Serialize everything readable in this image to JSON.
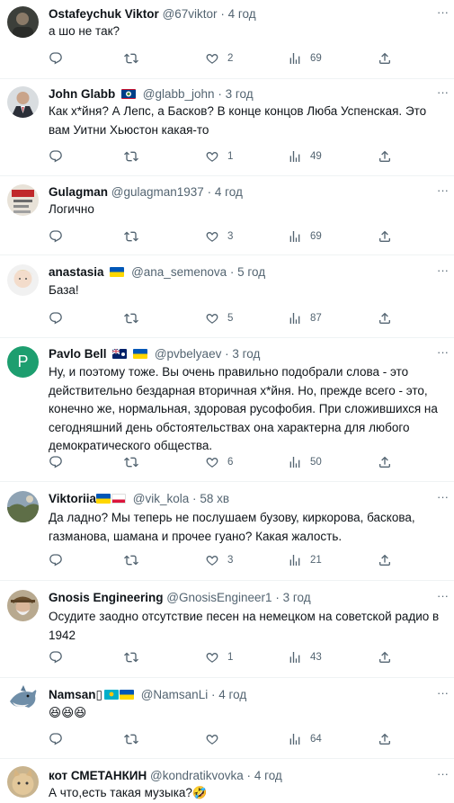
{
  "more_label": "···",
  "comments": [
    {
      "name": "Ostafeychuk Viktor",
      "handle": "@67viktor",
      "dot": "·",
      "time": "4 год",
      "text": "а шо не так?",
      "likes": "2",
      "views": "69",
      "avatar": "dark photo",
      "flags": []
    },
    {
      "name": "John Glabb",
      "handle": "@glabb_john",
      "dot": "·",
      "time": "3 год",
      "text": "Как х*йня? А Лепс, а Басков? В конце концов Люба Успенская. Это вам Уитни Хьюстон какая-то",
      "likes": "1",
      "views": "49",
      "avatar": "suit photo",
      "flags": [
        "belize"
      ]
    },
    {
      "name": "Gulagman",
      "handle": "@gulagman1937",
      "dot": "·",
      "time": "4 год",
      "text": "Логично",
      "likes": "3",
      "views": "69",
      "avatar": "poster",
      "flags": []
    },
    {
      "name": "anastasia",
      "handle": "@ana_semenova",
      "dot": "·",
      "time": "5 год",
      "text": "База!",
      "likes": "5",
      "views": "87",
      "avatar": "child photo",
      "flags": [
        "ukraine"
      ]
    },
    {
      "name": "Pavlo Bell",
      "handle": "@pvbelyaev",
      "dot": "·",
      "time": "3 год",
      "text": "Ну, и поэтому тоже. Вы очень правильно подобрали слова - это действительно бездарная вторичная х*йня. Но, прежде всего - это, конечно же, нормальная, здоровая русофобия. При сложившихся на сегодняшний день обстоятельствах она характерна для любого демократического общества.",
      "likes": "6",
      "views": "50",
      "avatar": "P",
      "avatar_color": "#1d9e6f",
      "flags": [
        "cayman",
        "ukraine"
      ]
    },
    {
      "name": "Viktoriia",
      "handle": "@vik_kola",
      "dot": "·",
      "time": "58 хв",
      "text": "Да ладно? Мы теперь не послушаем бузову, киркорова, баскова, газманова, шамана и прочее гуано? Какая жалость.",
      "likes": "3",
      "views": "21",
      "avatar": "landscape",
      "flags": [
        "ukraine",
        "poland"
      ]
    },
    {
      "name": "Gnosis Engineering",
      "handle": "@GnosisEngineer1",
      "dot": "·",
      "time": "3 год",
      "text": "Осудите заодно отсутствие песен на немецком на советской радио в 1942",
      "likes": "1",
      "views": "43",
      "avatar": "old man photo",
      "flags": []
    },
    {
      "name": "Namsan▯",
      "handle": "@NamsanLi",
      "dot": "·",
      "time": "4 год",
      "text": "😆😆😆",
      "likes": "",
      "views": "64",
      "avatar": "shark",
      "flags": [
        "kazakhstan",
        "ukraine"
      ]
    },
    {
      "name": "кот СМЕТАНКИН",
      "handle": "@kondratikvovka",
      "dot": "·",
      "time": "4 год",
      "text": "А что,есть такая музыка?🤣",
      "likes": "",
      "views": "",
      "avatar": "cat photo",
      "flags": []
    }
  ]
}
